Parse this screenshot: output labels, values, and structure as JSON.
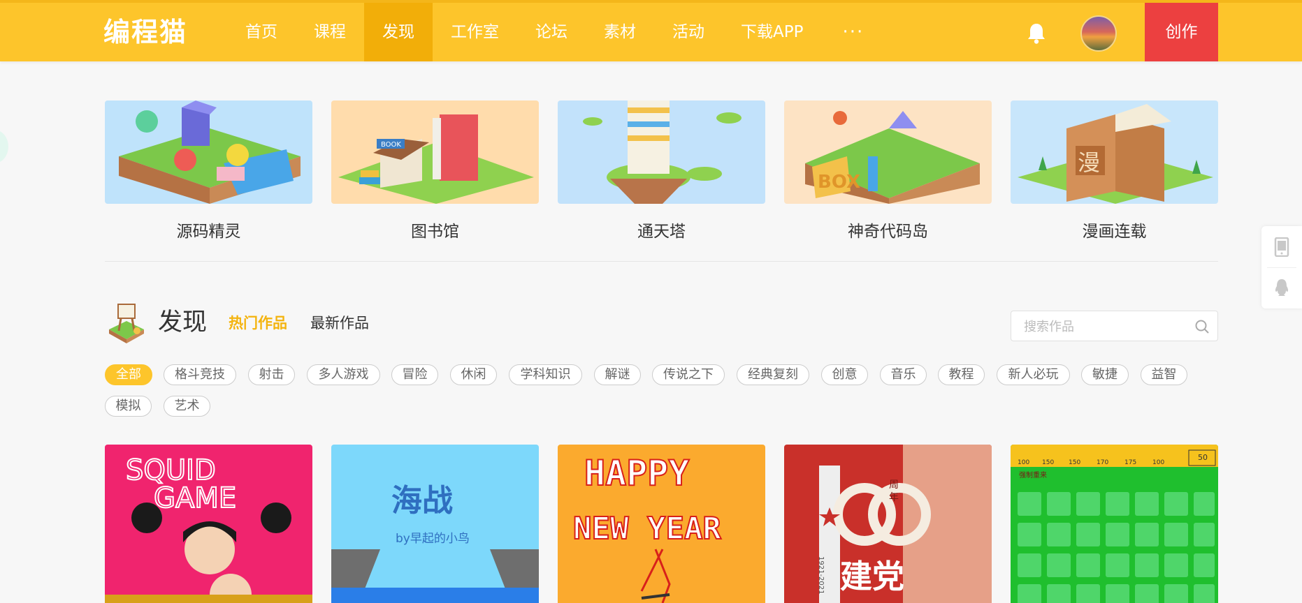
{
  "header": {
    "logo": "编程猫",
    "nav": [
      "首页",
      "课程",
      "发现",
      "工作室",
      "论坛",
      "素材",
      "活动",
      "下载APP"
    ],
    "nav_active_index": 2,
    "more": "···",
    "create": "创作",
    "icons": {
      "bell": "bell-icon",
      "avatar": "user-avatar"
    }
  },
  "categories": [
    {
      "label": "源码精灵"
    },
    {
      "label": "图书馆"
    },
    {
      "label": "通天塔"
    },
    {
      "label": "神奇代码岛"
    },
    {
      "label": "漫画连载"
    }
  ],
  "category_image_texts": {
    "book": "BOOK",
    "box": "BOX",
    "manga": "漫"
  },
  "discover": {
    "title": "发现",
    "tabs": [
      "热门作品",
      "最新作品"
    ],
    "active_tab": 0,
    "search_placeholder": "搜索作品"
  },
  "tags": [
    "全部",
    "格斗竞技",
    "射击",
    "多人游戏",
    "冒险",
    "休闲",
    "学科知识",
    "解谜",
    "传说之下",
    "经典复刻",
    "创意",
    "音乐",
    "教程",
    "新人必玩",
    "敏捷",
    "益智",
    "模拟",
    "艺术"
  ],
  "active_tag": 0,
  "works": [
    {
      "cover_text": [
        "SQUID",
        "GAME"
      ]
    },
    {
      "cover_text": [
        "海战",
        "by早起的小鸟"
      ]
    },
    {
      "cover_text": [
        "HAPPY",
        "NEW YEAR"
      ]
    },
    {
      "cover_text": [
        "周",
        "年",
        "1921-2021",
        "建党"
      ]
    },
    {
      "cover_text": [
        "100",
        "150",
        "150",
        "170",
        "175",
        "100",
        "50",
        "强制重来"
      ]
    }
  ],
  "side_icons": [
    "phone-icon",
    "qq-penguin-icon"
  ],
  "colors": {
    "brand": "#fdc52b",
    "brand_dark": "#f2ae09",
    "create": "#ec4040",
    "tab_active": "#f4b40f"
  }
}
